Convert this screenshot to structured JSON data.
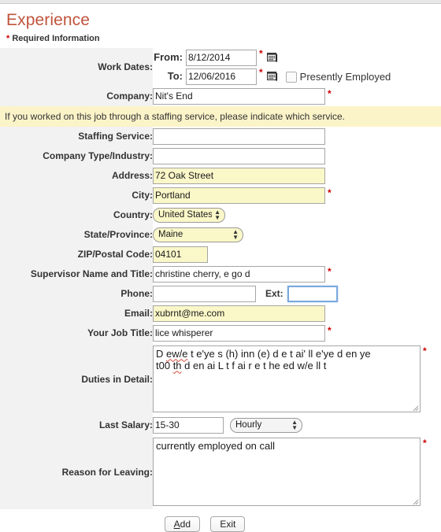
{
  "page": {
    "title": "Experience",
    "required_note_star": "*",
    "required_note": "Required Information",
    "title_color": "#c0543c",
    "required_color": "#cc0000",
    "notice_bg": "#fcf4c9",
    "label_bg": "#f2f2f2",
    "autofill_bg": "#faf7c8",
    "focus_color": "#7aa9dd"
  },
  "fields": {
    "work_dates": {
      "label": "Work Dates:",
      "from_label": "From:",
      "from_value": "8/12/2014",
      "to_label": "To:",
      "to_value": "12/06/2016",
      "calendar_icon": "calendar-icon",
      "presently_employed_label": "Presently Employed",
      "presently_employed_checked": false
    },
    "company": {
      "label": "Company:",
      "value": "Nit's End",
      "required": true
    },
    "staffing_notice": "If you worked on this job through a staffing service, please indicate which service.",
    "staffing_service": {
      "label": "Staffing Service:",
      "value": "",
      "required": false
    },
    "company_type": {
      "label": "Company Type/Industry:",
      "value": "",
      "required": false
    },
    "address": {
      "label": "Address:",
      "value": "72 Oak Street",
      "required": false
    },
    "city": {
      "label": "City:",
      "value": "Portland",
      "required": true
    },
    "country": {
      "label": "Country:",
      "value": "United States"
    },
    "state": {
      "label": "State/Province:",
      "value": "Maine"
    },
    "zip": {
      "label": "ZIP/Postal Code:",
      "value": "04101"
    },
    "supervisor": {
      "label": "Supervisor Name and Title:",
      "value": "christine cherry, e go d",
      "required": true
    },
    "phone": {
      "label": "Phone:",
      "value": ""
    },
    "ext": {
      "label": "Ext:",
      "value": "",
      "focused": true
    },
    "email": {
      "label": "Email:",
      "value": "xubrnt@me.com"
    },
    "job_title": {
      "label": "Your Job Title:",
      "value": "lice whisperer",
      "required": true
    },
    "duties": {
      "label": "Duties in Detail:",
      "value": "D ew/e t e'ye s (h) inn (e) d e t ai' ll e'ye d en ye t00 th d en ai L t f ai r e t he ed w/e ll t",
      "line1_pre": "D ",
      "line1_misspelled": "ew/e",
      "line1_post": " t e'ye s (h) inn (e) d e t ai' ll e'ye d en ye",
      "line2_pre": "t00 ",
      "line2_misspelled": "th",
      "line2_post": " d en ai L t f ai r e t he ed w/e ll t",
      "required": true
    },
    "last_salary": {
      "label": "Last Salary:",
      "value": "15-30",
      "rate": "Hourly"
    },
    "reason_for_leaving": {
      "label": "Reason for Leaving:",
      "value": "currently employed on call",
      "required": true
    }
  },
  "buttons": {
    "add_underline": "A",
    "add_rest": "dd",
    "add_label": "Add",
    "exit_label": "Exit"
  }
}
